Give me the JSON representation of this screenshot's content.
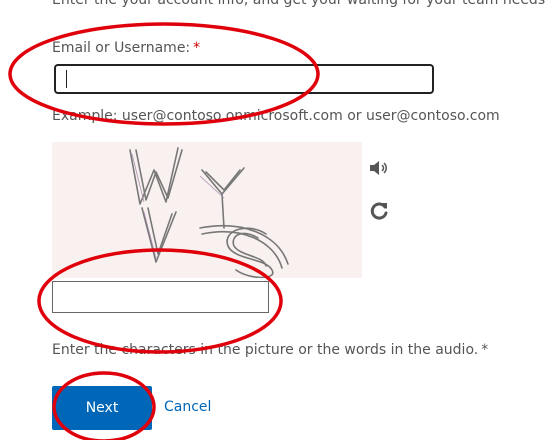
{
  "form": {
    "intro_text": "Enter the your account info, and get your waiting for your team needs",
    "email_label": "Email or Username:",
    "required_marker": "*",
    "email_value": "",
    "example_text": "Example: user@contoso.onmicrosoft.com or user@contoso.com",
    "captcha_value": "",
    "captcha_instruction": "Enter the characters in the picture or the words in the audio.",
    "next_label": "Next",
    "cancel_label": "Cancel"
  },
  "captcha": {
    "characters": "WYVS"
  },
  "icons": {
    "audio": "speaker-icon",
    "refresh": "refresh-icon"
  },
  "colors": {
    "primary": "#0067b8",
    "annotation": "#e0000b",
    "captcha_bg": "#f8f1ef"
  }
}
